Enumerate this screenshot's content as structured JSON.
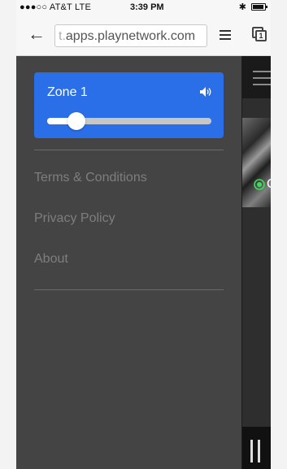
{
  "status_bar": {
    "carrier": "●●●○○ AT&T  LTE",
    "time": "3:39 PM",
    "bluetooth": "✱"
  },
  "browser": {
    "url_prefix": "t.",
    "url_text": "apps.playnetwork.com"
  },
  "zone": {
    "name": "Zone 1",
    "volume_fraction": 0.18,
    "card_color": "#2a6ee8"
  },
  "menu": {
    "items": [
      {
        "label": "Terms & Conditions"
      },
      {
        "label": "Privacy Policy"
      },
      {
        "label": "About"
      }
    ]
  },
  "peek": {
    "title_letter": "C",
    "status_color": "#3ddc5a"
  }
}
